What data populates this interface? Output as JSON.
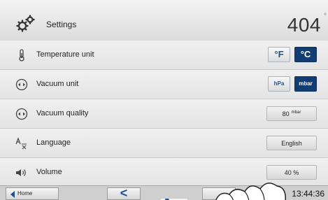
{
  "header": {
    "title": "Settings",
    "temperature": "404",
    "degree": "°",
    "icon": "gears-icon"
  },
  "rows": [
    {
      "label": "Temperature unit",
      "icon": "thermometer-icon",
      "options": [
        "°F",
        "°C"
      ],
      "selected": "°C"
    },
    {
      "label": "Vacuum unit",
      "icon": "vacuum-gauge-icon",
      "options": [
        "hPa",
        "mbar"
      ],
      "selected": "mbar"
    },
    {
      "label": "Vacuum quality",
      "icon": "vacuum-gauge-icon",
      "value": "80",
      "unit": "mbar"
    },
    {
      "label": "Language",
      "icon": "language-icon",
      "value": "English"
    },
    {
      "label": "Volume",
      "icon": "speaker-icon",
      "value": "40 %"
    }
  ],
  "footer": {
    "home_label": "Home",
    "back_symbol": "<",
    "time": "13:44:36",
    "page_position": 0.2
  },
  "colors": {
    "accent": "#123d73",
    "accent_text": "#1f4f8c",
    "background": "#ececec"
  }
}
